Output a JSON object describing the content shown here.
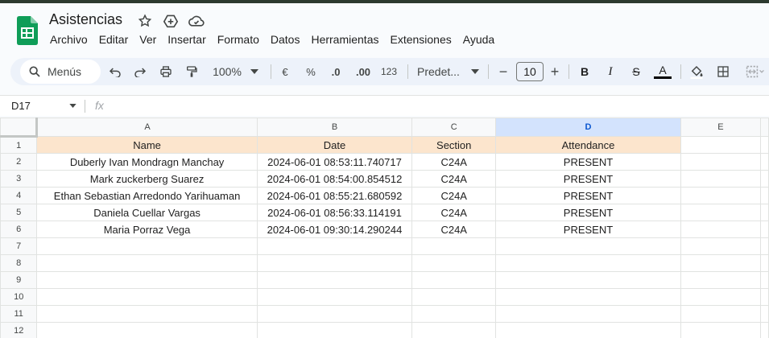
{
  "app": {
    "title": "Asistencias",
    "menu": [
      "Archivo",
      "Editar",
      "Ver",
      "Insertar",
      "Formato",
      "Datos",
      "Herramientas",
      "Extensiones",
      "Ayuda"
    ]
  },
  "toolbar": {
    "search_label": "Menús",
    "zoom": "100%",
    "currency": "€",
    "percent": "%",
    "decrease_decimal": ".0",
    "increase_decimal": ".00",
    "number_format": "123",
    "font_name": "Predet...",
    "font_size": "10",
    "minus": "−",
    "plus": "+",
    "bold": "B",
    "italic": "I",
    "strike": "S",
    "text_color": "A"
  },
  "formula_bar": {
    "cell_ref": "D17",
    "fx": "fx"
  },
  "sheet": {
    "columns": [
      "A",
      "B",
      "C",
      "D",
      "E"
    ],
    "selected_column": "D",
    "rows": [
      "1",
      "2",
      "3",
      "4",
      "5",
      "6",
      "7",
      "8",
      "9",
      "10",
      "11",
      "12"
    ],
    "header": [
      "Name",
      "Date",
      "Section",
      "Attendance",
      ""
    ],
    "data": [
      [
        "Duberly Ivan Mondragn Manchay",
        "2024-06-01 08:53:11.740717",
        "C24A",
        "PRESENT",
        ""
      ],
      [
        "Mark zuckerberg Suarez",
        "2024-06-01 08:54:00.854512",
        "C24A",
        "PRESENT",
        ""
      ],
      [
        "Ethan Sebastian Arredondo Yarihuaman",
        "2024-06-01 08:55:21.680592",
        "C24A",
        "PRESENT",
        ""
      ],
      [
        "Daniela Cuellar Vargas",
        "2024-06-01 08:56:33.114191",
        "C24A",
        "PRESENT",
        ""
      ],
      [
        "Maria Porraz Vega",
        "2024-06-01 09:30:14.290244",
        "C24A",
        "PRESENT",
        ""
      ]
    ]
  },
  "colors": {
    "header_fill": "#fce5cd",
    "selected_column": "#d3e3fd",
    "logo_green": "#0f9d58"
  }
}
